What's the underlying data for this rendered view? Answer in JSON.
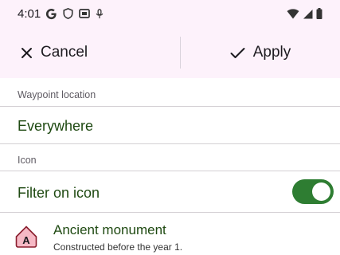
{
  "status_bar": {
    "time": "4:01",
    "icons_left": [
      "google-icon",
      "shield-icon",
      "screen-icon",
      "mic-icon"
    ],
    "icons_right": [
      "wifi-icon",
      "signal-icon",
      "battery-icon"
    ]
  },
  "action_bar": {
    "cancel_label": "Cancel",
    "apply_label": "Apply"
  },
  "waypoint_section": {
    "label": "Waypoint location",
    "value": "Everywhere"
  },
  "icon_section": {
    "label": "Icon",
    "filter_label": "Filter on icon",
    "filter_on": true
  },
  "icon_list": [
    {
      "icon": "letter-a-marker-icon",
      "letter": "A",
      "title": "Ancient monument",
      "subtitle": "Constructed before the year 1."
    }
  ],
  "colors": {
    "accent": "#2e7d32",
    "value_text": "#1f4a12",
    "header_bg": "#fdf2fb",
    "marker_fill": "#f6b9c5",
    "marker_stroke": "#8a1e2e"
  }
}
